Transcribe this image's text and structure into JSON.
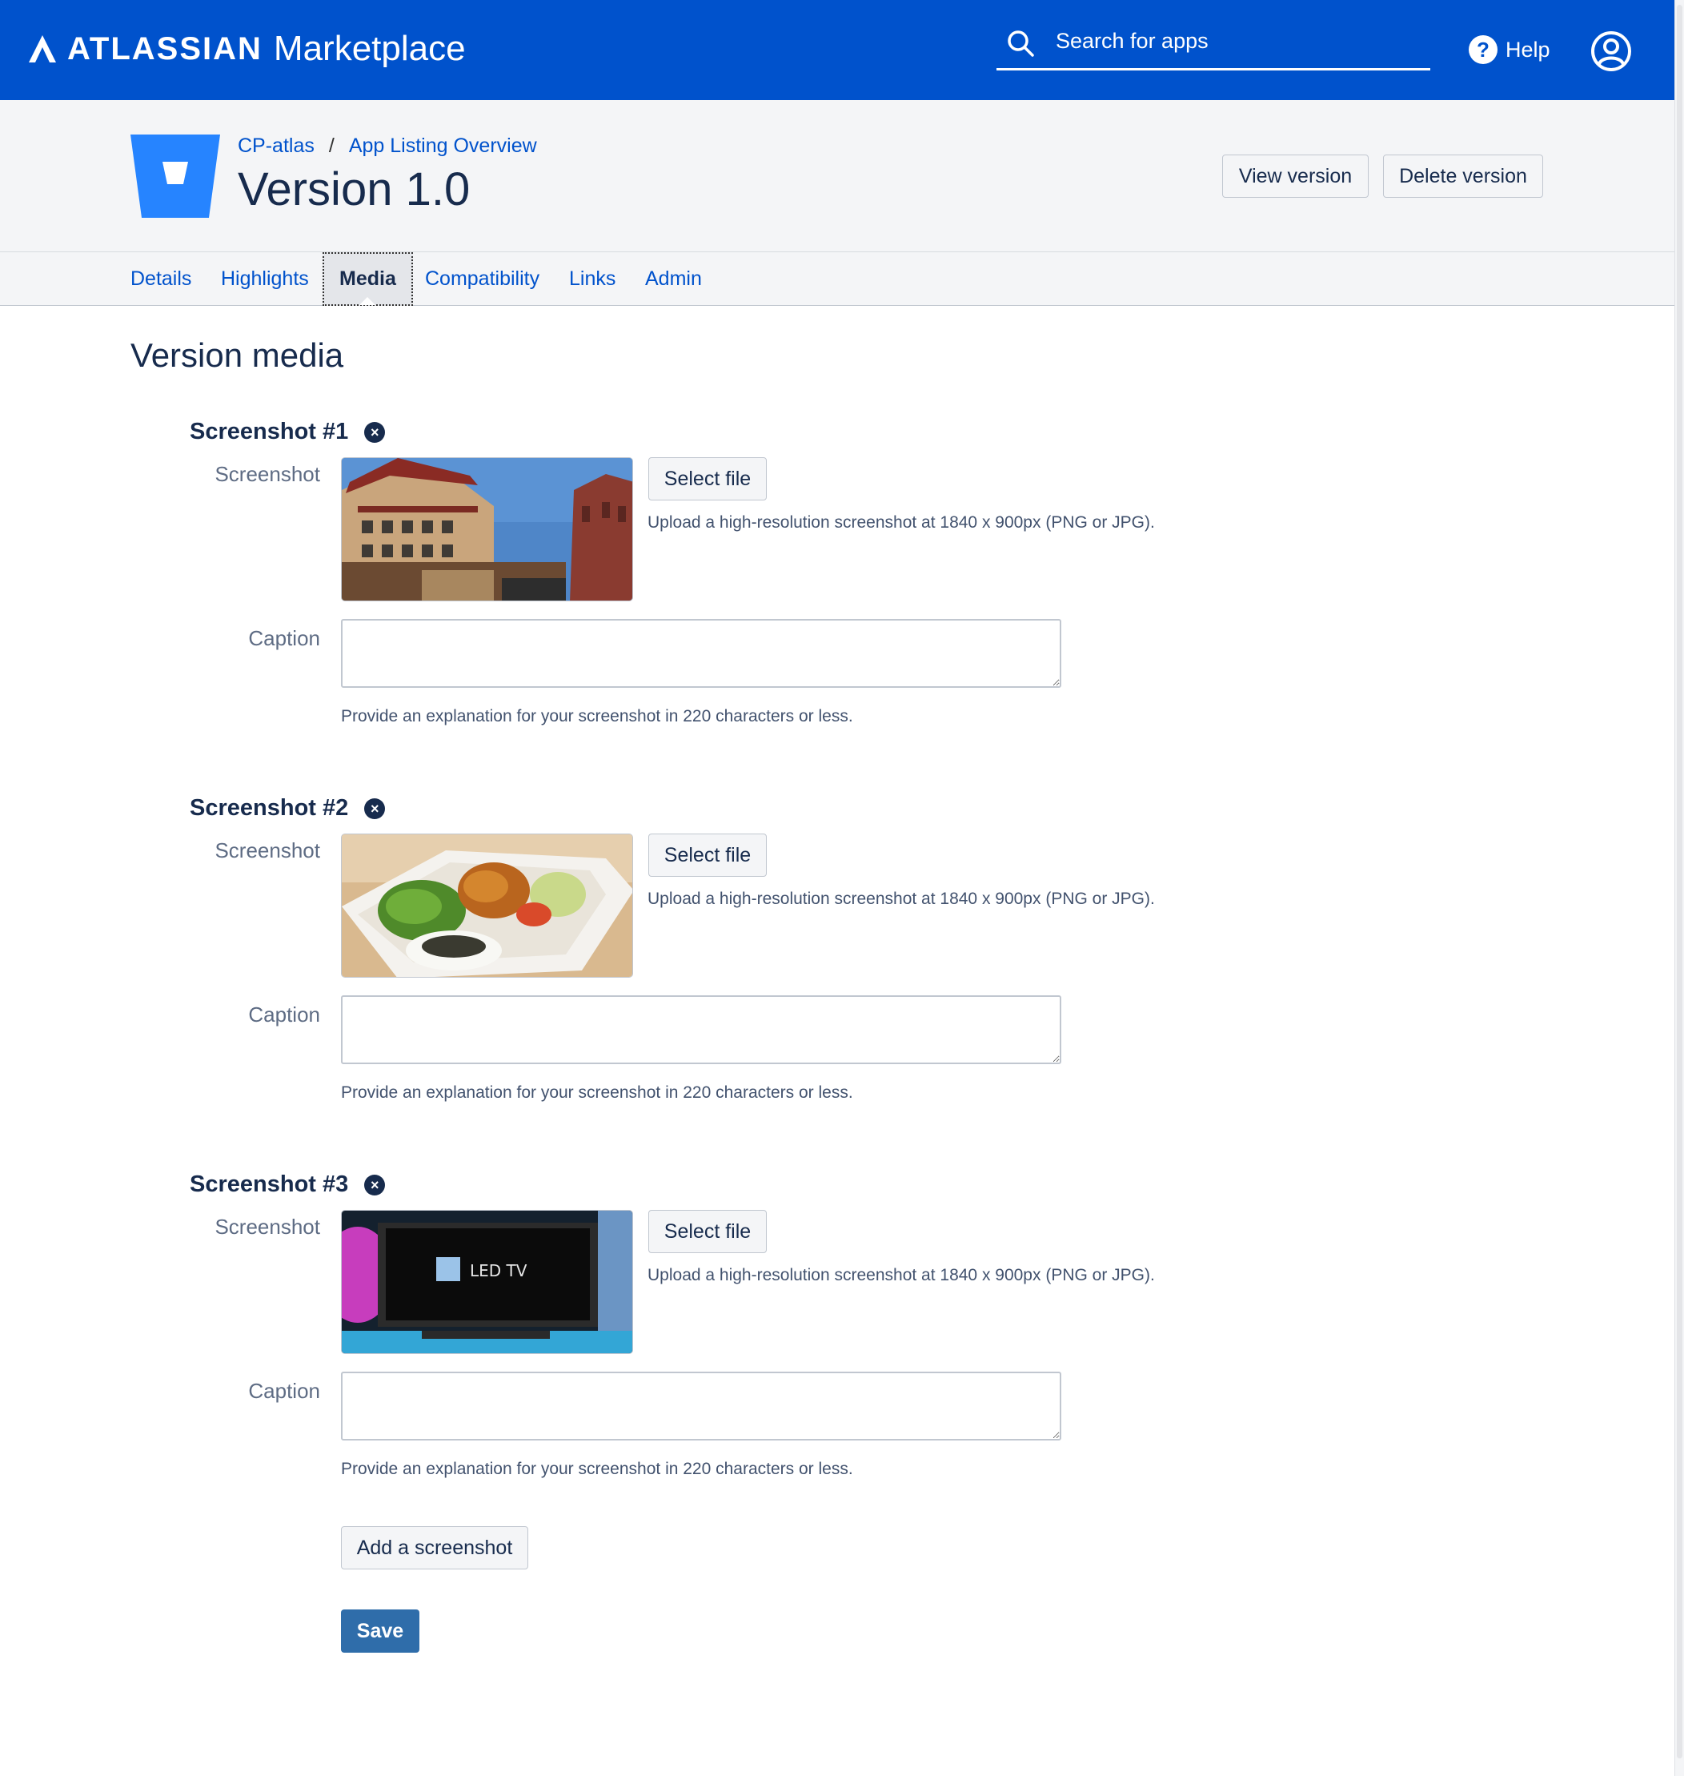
{
  "topnav": {
    "brand": "ATLASSIAN",
    "product": "Marketplace",
    "search_placeholder": "Search for apps",
    "help_label": "Help",
    "help_glyph": "?"
  },
  "header": {
    "breadcrumb": [
      "CP-atlas",
      "App Listing Overview"
    ],
    "breadcrumb_sep": "/",
    "title": "Version 1.0",
    "view_label": "View version",
    "delete_label": "Delete version"
  },
  "tabs": [
    {
      "label": "Details",
      "active": false
    },
    {
      "label": "Highlights",
      "active": false
    },
    {
      "label": "Media",
      "active": true
    },
    {
      "label": "Compatibility",
      "active": false
    },
    {
      "label": "Links",
      "active": false
    },
    {
      "label": "Admin",
      "active": false
    }
  ],
  "section_title": "Version media",
  "screenshots": [
    {
      "heading": "Screenshot #1",
      "screenshot_label": "Screenshot",
      "select_label": "Select file",
      "upload_hint": "Upload a high-resolution screenshot at 1840 x 900px (PNG or JPG).",
      "caption_label": "Caption",
      "caption_value": "",
      "caption_hint": "Provide an explanation for your screenshot in 220 characters or less.",
      "thumbnail": "chinatown-building-photo"
    },
    {
      "heading": "Screenshot #2",
      "screenshot_label": "Screenshot",
      "select_label": "Select file",
      "upload_hint": "Upload a high-resolution screenshot at 1840 x 900px (PNG or JPG).",
      "caption_label": "Caption",
      "caption_value": "",
      "caption_hint": "Provide an explanation for your screenshot in 220 characters or less.",
      "thumbnail": "bento-box-photo"
    },
    {
      "heading": "Screenshot #3",
      "screenshot_label": "Screenshot",
      "select_label": "Select file",
      "upload_hint": "Upload a high-resolution screenshot at 1840 x 900px (PNG or JPG).",
      "caption_label": "Caption",
      "caption_value": "",
      "caption_hint": "Provide an explanation for your screenshot in 220 characters or less.",
      "thumbnail": "led-tv-photo",
      "thumbnail_text": "LED TV"
    }
  ],
  "remove_glyph": "×",
  "add_screenshot_label": "Add a screenshot",
  "save_label": "Save",
  "colors": {
    "nav_bg": "#0052cc",
    "header_bg": "#f4f5f7",
    "link": "#0052cc",
    "primary_button": "#2f6daa",
    "text": "#172b4d"
  },
  "icons": [
    "atlassian-logo-icon",
    "search-icon",
    "help-icon",
    "user-avatar-icon",
    "app-logo-icon",
    "remove-screenshot-icon"
  ]
}
